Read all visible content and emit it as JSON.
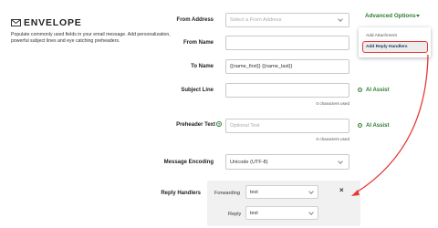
{
  "section": {
    "title": "ENVELOPE",
    "description": "Populate commonly used fields in your email message. Add personalization, powerful subject lines and eye catching preheaders.",
    "icon": "envelope-icon"
  },
  "advanced_options": {
    "label": "Advanced Options",
    "menu": [
      "Add Attachment",
      "Add Reply Handlers"
    ]
  },
  "fields": {
    "from_address": {
      "label": "From Address",
      "placeholder": "Select a From Address"
    },
    "from_name": {
      "label": "From Name",
      "value": ""
    },
    "to_name": {
      "label": "To Name",
      "value": "{{name_first}} {{name_last}}"
    },
    "subject_line": {
      "label": "Subject Line",
      "value": "",
      "counter": "0 characters used"
    },
    "preheader_text": {
      "label": "Preheader Text",
      "placeholder": "Optional Text",
      "counter": "0 characters used",
      "info_icon": "?"
    },
    "message_encoding": {
      "label": "Message Encoding",
      "value": "Unicode (UTF-8)"
    }
  },
  "ai_assist": {
    "label": "AI Assist"
  },
  "reply_handlers": {
    "label": "Reply Handlers",
    "forwarding": {
      "label": "Forwarding",
      "value": "test"
    },
    "reply": {
      "label": "Reply",
      "value": "test"
    },
    "close": "×"
  },
  "colors": {
    "accent_green": "#2e7d32",
    "highlight_red": "#e53935"
  }
}
